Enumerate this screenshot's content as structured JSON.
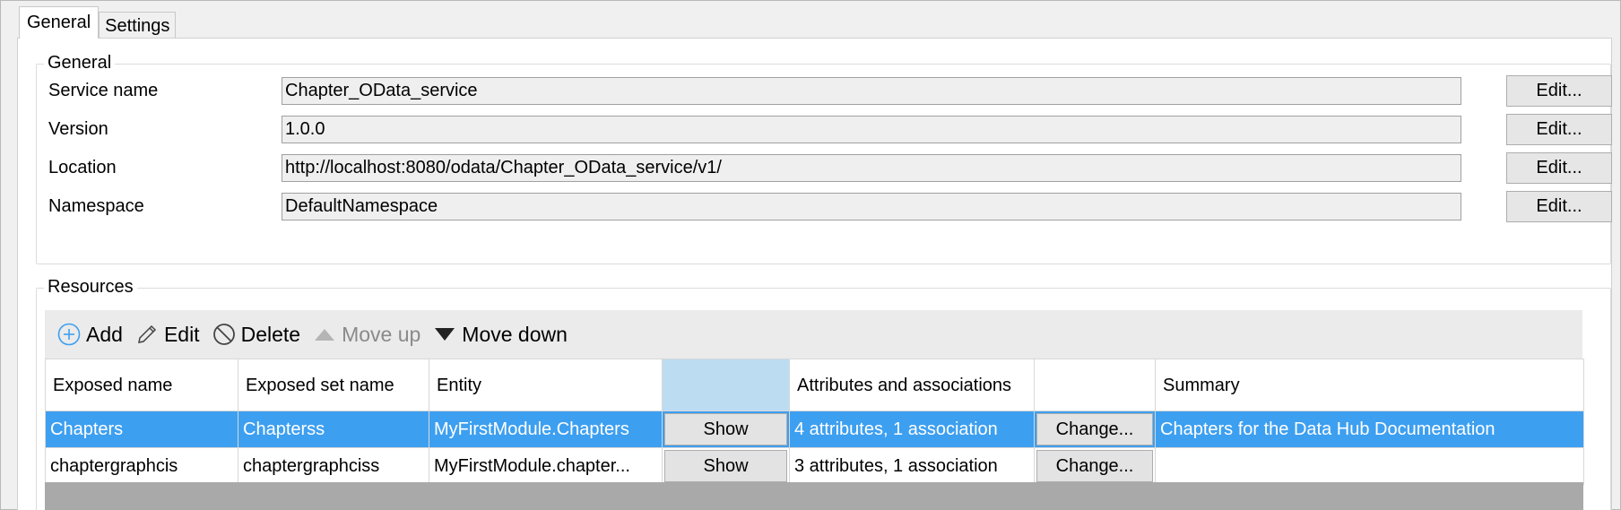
{
  "tabs": [
    {
      "label": "General",
      "active": true
    },
    {
      "label": "Settings",
      "active": false
    }
  ],
  "general": {
    "title": "General",
    "fields": [
      {
        "label": "Service name",
        "value": "Chapter_OData_service",
        "button": "Edit..."
      },
      {
        "label": "Version",
        "value": "1.0.0",
        "button": "Edit..."
      },
      {
        "label": "Location",
        "value": "http://localhost:8080/odata/Chapter_OData_service/v1/",
        "button": "Edit..."
      },
      {
        "label": "Namespace",
        "value": "DefaultNamespace",
        "button": "Edit..."
      }
    ]
  },
  "resources": {
    "title": "Resources",
    "toolbar": {
      "add": "Add",
      "edit": "Edit",
      "delete": "Delete",
      "move_up": "Move up",
      "move_down": "Move down"
    },
    "columns": [
      "Exposed name",
      "Exposed set name",
      "Entity",
      "",
      "Attributes and associations",
      "",
      "Summary"
    ],
    "rows": [
      {
        "exposed_name": "Chapters",
        "exposed_set_name": "Chapterss",
        "entity": "MyFirstModule.Chapters",
        "show": "Show",
        "attributes": "4 attributes, 1 association",
        "change": "Change...",
        "summary": "Chapters for the Data Hub Documentation",
        "selected": true
      },
      {
        "exposed_name": "chaptergraphcis",
        "exposed_set_name": "chaptergraphciss",
        "entity": "MyFirstModule.chapter...",
        "show": "Show",
        "attributes": "3 attributes, 1 association",
        "change": "Change...",
        "summary": "",
        "selected": false
      }
    ]
  },
  "colors": {
    "selection": "#3d9ff0",
    "selected_column_header": "#bcdcf2",
    "add_icon": "#3d9ff0"
  },
  "icons": {
    "add": "plus-circle-icon",
    "edit": "pencil-icon",
    "delete": "prohibit-icon",
    "move_up": "triangle-up-icon",
    "move_down": "triangle-down-icon"
  }
}
